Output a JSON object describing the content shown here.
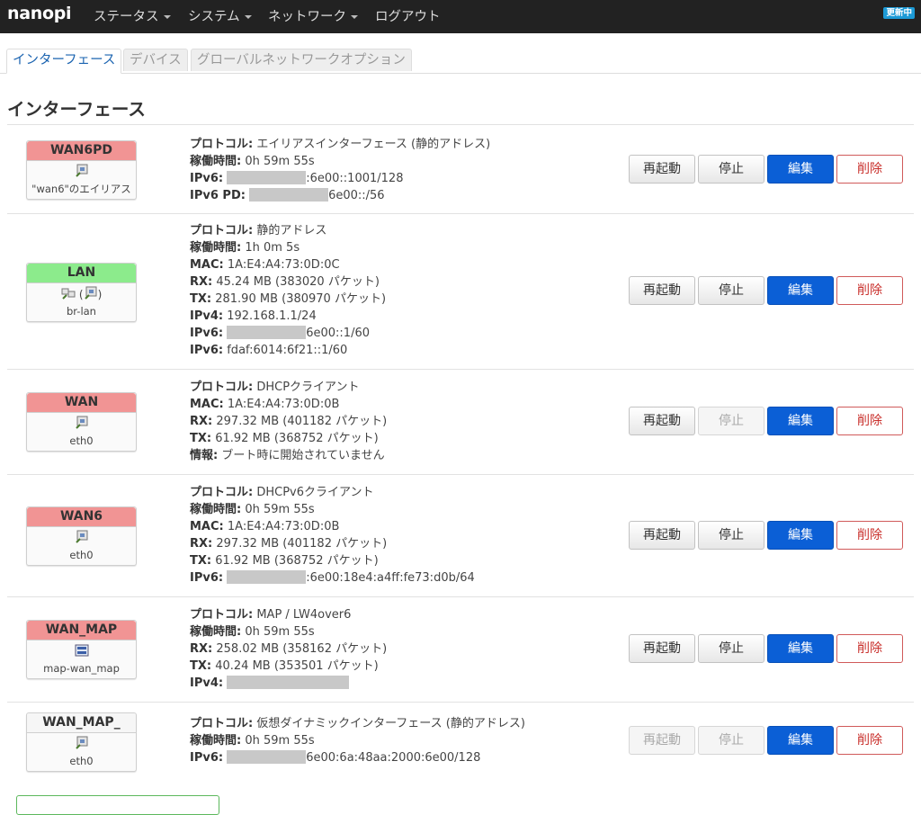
{
  "header": {
    "brand": "nanopi",
    "menu": [
      "ステータス",
      "システム",
      "ネットワーク",
      "ログアウト"
    ],
    "update_badge": "更新中"
  },
  "tabs": [
    "インターフェース",
    "デバイス",
    "グローバルネットワークオプション"
  ],
  "section_title": "インターフェース",
  "buttons": {
    "restart": "再起動",
    "stop": "停止",
    "edit": "編集",
    "delete": "削除"
  },
  "interfaces": [
    {
      "name": "WAN6PD",
      "device": "\"wan6\"のエイリアス",
      "color": "#f19494",
      "lines": [
        {
          "label": "プロトコル:",
          "value": "エイリアスインターフェース (静的アドレス)"
        },
        {
          "label": "稼働時間:",
          "value": "0h 59m 55s"
        },
        {
          "label": "IPv6:",
          "value": ":6e00::1001/128"
        },
        {
          "label": "IPv6 PD:",
          "value": "6e00::/56"
        }
      ]
    },
    {
      "name": "LAN",
      "device": "br-lan",
      "color": "#8ceb8c",
      "lines": [
        {
          "label": "プロトコル:",
          "value": "静的アドレス"
        },
        {
          "label": "稼働時間:",
          "value": "1h 0m 5s"
        },
        {
          "label": "MAC:",
          "value": "1A:E4:A4:73:0D:0C"
        },
        {
          "label": "RX:",
          "value": "45.24 MB (383020 パケット)"
        },
        {
          "label": "TX:",
          "value": "281.90 MB (380970 パケット)"
        },
        {
          "label": "IPv4:",
          "value": "192.168.1.1/24"
        },
        {
          "label": "IPv6:",
          "value": "6e00::1/60"
        },
        {
          "label": "IPv6:",
          "value": "fdaf:6014:6f21::1/60"
        }
      ]
    },
    {
      "name": "WAN",
      "device": "eth0",
      "color": "#f19494",
      "lines": [
        {
          "label": "プロトコル:",
          "value": "DHCPクライアント"
        },
        {
          "label": "MAC:",
          "value": "1A:E4:A4:73:0D:0B"
        },
        {
          "label": "RX:",
          "value": "297.32 MB (401182 パケット)"
        },
        {
          "label": "TX:",
          "value": "61.92 MB (368752 パケット)"
        },
        {
          "label": "情報:",
          "value": "ブート時に開始されていません"
        }
      ]
    },
    {
      "name": "WAN6",
      "device": "eth0",
      "color": "#f19494",
      "lines": [
        {
          "label": "プロトコル:",
          "value": "DHCPv6クライアント"
        },
        {
          "label": "稼働時間:",
          "value": "0h 59m 55s"
        },
        {
          "label": "MAC:",
          "value": "1A:E4:A4:73:0D:0B"
        },
        {
          "label": "RX:",
          "value": "297.32 MB (401182 パケット)"
        },
        {
          "label": "TX:",
          "value": "61.92 MB (368752 パケット)"
        },
        {
          "label": "IPv6:",
          "value": ":6e00:18e4:a4ff:fe73:d0b/64"
        }
      ]
    },
    {
      "name": "WAN_MAP",
      "device": "map-wan_map",
      "color": "#f19494",
      "lines": [
        {
          "label": "プロトコル:",
          "value": "MAP / LW4over6"
        },
        {
          "label": "稼働時間:",
          "value": "0h 59m 55s"
        },
        {
          "label": "RX:",
          "value": "258.02 MB (358162 パケット)"
        },
        {
          "label": "TX:",
          "value": "40.24 MB (353501 パケット)"
        },
        {
          "label": "IPv4:",
          "value": ""
        }
      ]
    },
    {
      "name": "WAN_MAP_",
      "device": "eth0",
      "color": "#f6f6f6",
      "lines": [
        {
          "label": "プロトコル:",
          "value": "仮想ダイナミックインターフェース (静的アドレス)"
        },
        {
          "label": "稼働時間:",
          "value": "0h 59m 55s"
        },
        {
          "label": "IPv6:",
          "value": "6e00:6a:48aa:2000:6e00/128"
        }
      ]
    }
  ]
}
